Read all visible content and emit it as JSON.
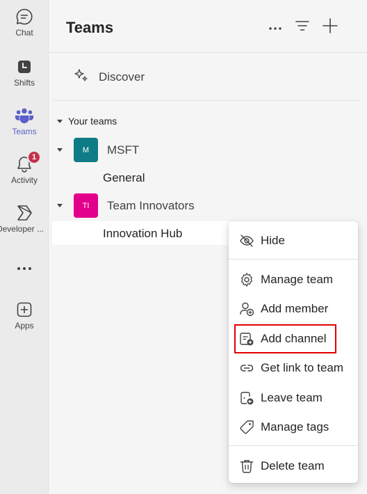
{
  "rail": {
    "items": [
      {
        "label": "Chat",
        "icon": "chat-icon"
      },
      {
        "label": "Shifts",
        "icon": "shifts-icon"
      },
      {
        "label": "Teams",
        "icon": "teams-icon",
        "active": true
      },
      {
        "label": "Activity",
        "icon": "bell-icon",
        "badge": "1"
      },
      {
        "label": "Developer ...",
        "icon": "developer-portal-icon"
      },
      {
        "label": "",
        "icon": "more-icon"
      },
      {
        "label": "Apps",
        "icon": "add-apps-icon"
      }
    ]
  },
  "header": {
    "title": "Teams",
    "actions": [
      "more-options-icon",
      "filter-icon",
      "add-icon"
    ]
  },
  "discover": {
    "label": "Discover",
    "icon": "sparkle-icon"
  },
  "teams_section": {
    "label": "Your teams",
    "teams": [
      {
        "name": "MSFT",
        "initials": "M",
        "color": "#0e7c86",
        "channels": [
          "General"
        ]
      },
      {
        "name": "Team Innovators",
        "initials": "TI",
        "color": "#e3008c",
        "channels": [
          "Innovation Hub"
        ]
      }
    ]
  },
  "context_menu": {
    "items": [
      {
        "label": "Hide",
        "icon": "hide-eye-icon"
      },
      {
        "label": "Manage team",
        "icon": "gear-icon"
      },
      {
        "label": "Add member",
        "icon": "add-member-icon"
      },
      {
        "label": "Add channel",
        "icon": "add-channel-icon",
        "highlighted": true
      },
      {
        "label": "Get link to team",
        "icon": "link-icon"
      },
      {
        "label": "Leave team",
        "icon": "leave-team-icon"
      },
      {
        "label": "Manage tags",
        "icon": "tag-icon"
      },
      {
        "label": "Delete team",
        "icon": "trash-icon"
      }
    ]
  },
  "colors": {
    "accent": "#5b5fc7",
    "badge": "#c4314b",
    "highlight_border": "#e00000"
  }
}
